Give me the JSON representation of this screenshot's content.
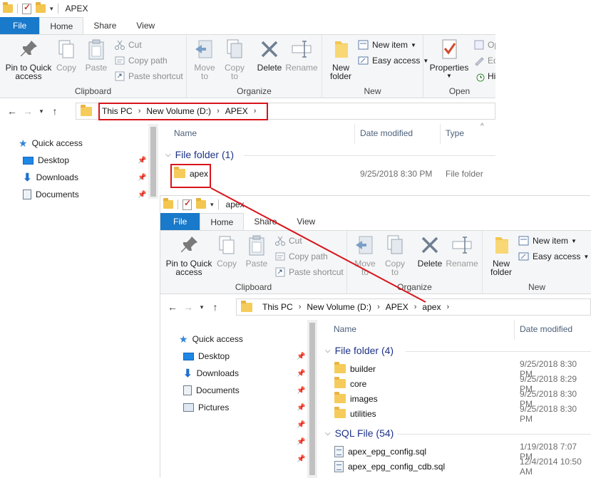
{
  "window1": {
    "title": "APEX",
    "tabs": [
      "File",
      "Home",
      "Share",
      "View"
    ],
    "ribbon": {
      "clipboard": {
        "label": "Clipboard",
        "pin": "Pin to Quick access",
        "copy": "Copy",
        "paste": "Paste",
        "cut": "Cut",
        "copy_path": "Copy path",
        "paste_shortcut": "Paste shortcut"
      },
      "organize": {
        "label": "Organize",
        "move_to": "Move to",
        "copy_to": "Copy to",
        "delete": "Delete",
        "rename": "Rename"
      },
      "new": {
        "label": "New",
        "new_folder": "New folder",
        "new_item": "New item",
        "easy_access": "Easy access"
      },
      "open": {
        "label": "Open",
        "properties": "Properties",
        "op": "Op",
        "ed": "Ed",
        "his": "His"
      }
    },
    "breadcrumb": [
      "This PC",
      "New Volume (D:)",
      "APEX"
    ],
    "nav": [
      {
        "label": "Quick access",
        "icon": "star-icon"
      },
      {
        "label": "Desktop",
        "icon": "desktop-icon"
      },
      {
        "label": "Downloads",
        "icon": "download-icon"
      },
      {
        "label": "Documents",
        "icon": "documents-icon"
      }
    ],
    "columns": {
      "name": "Name",
      "date": "Date modified",
      "type": "Type"
    },
    "group": "File folder (1)",
    "files": [
      {
        "name": "apex",
        "date": "9/25/2018 8:30 PM",
        "type": "File folder"
      }
    ]
  },
  "window2": {
    "title": "apex",
    "tabs": [
      "File",
      "Home",
      "Share",
      "View"
    ],
    "ribbon": {
      "clipboard": {
        "label": "Clipboard",
        "pin": "Pin to Quick access",
        "copy": "Copy",
        "paste": "Paste",
        "cut": "Cut",
        "copy_path": "Copy path",
        "paste_shortcut": "Paste shortcut"
      },
      "organize": {
        "label": "Organize",
        "move_to": "Move to",
        "copy_to": "Copy to",
        "delete": "Delete",
        "rename": "Rename"
      },
      "new": {
        "label": "New",
        "new_folder": "New folder",
        "new_item": "New item",
        "easy_access": "Easy access"
      }
    },
    "breadcrumb": [
      "This PC",
      "New Volume (D:)",
      "APEX",
      "apex"
    ],
    "nav": [
      {
        "label": "Quick access",
        "icon": "star-icon"
      },
      {
        "label": "Desktop",
        "icon": "desktop-icon"
      },
      {
        "label": "Downloads",
        "icon": "download-icon"
      },
      {
        "label": "Documents",
        "icon": "documents-icon"
      },
      {
        "label": "Pictures",
        "icon": "pictures-icon"
      }
    ],
    "columns": {
      "name": "Name",
      "date": "Date modified"
    },
    "group_folders": "File folder (4)",
    "folders": [
      {
        "name": "builder",
        "date": "9/25/2018 8:30 PM"
      },
      {
        "name": "core",
        "date": "9/25/2018 8:29 PM"
      },
      {
        "name": "images",
        "date": "9/25/2018 8:30 PM"
      },
      {
        "name": "utilities",
        "date": "9/25/2018 8:30 PM"
      }
    ],
    "group_sql": "SQL File (54)",
    "sql_files": [
      {
        "name": "apex_epg_config.sql",
        "date": "1/19/2018 7:07 PM"
      },
      {
        "name": "apex_epg_config_cdb.sql",
        "date": "12/4/2014 10:50 AM"
      }
    ]
  },
  "colors": {
    "file_tab": "#1979ca",
    "annotation_red": "#d8151b",
    "group_header": "#1e3287"
  }
}
